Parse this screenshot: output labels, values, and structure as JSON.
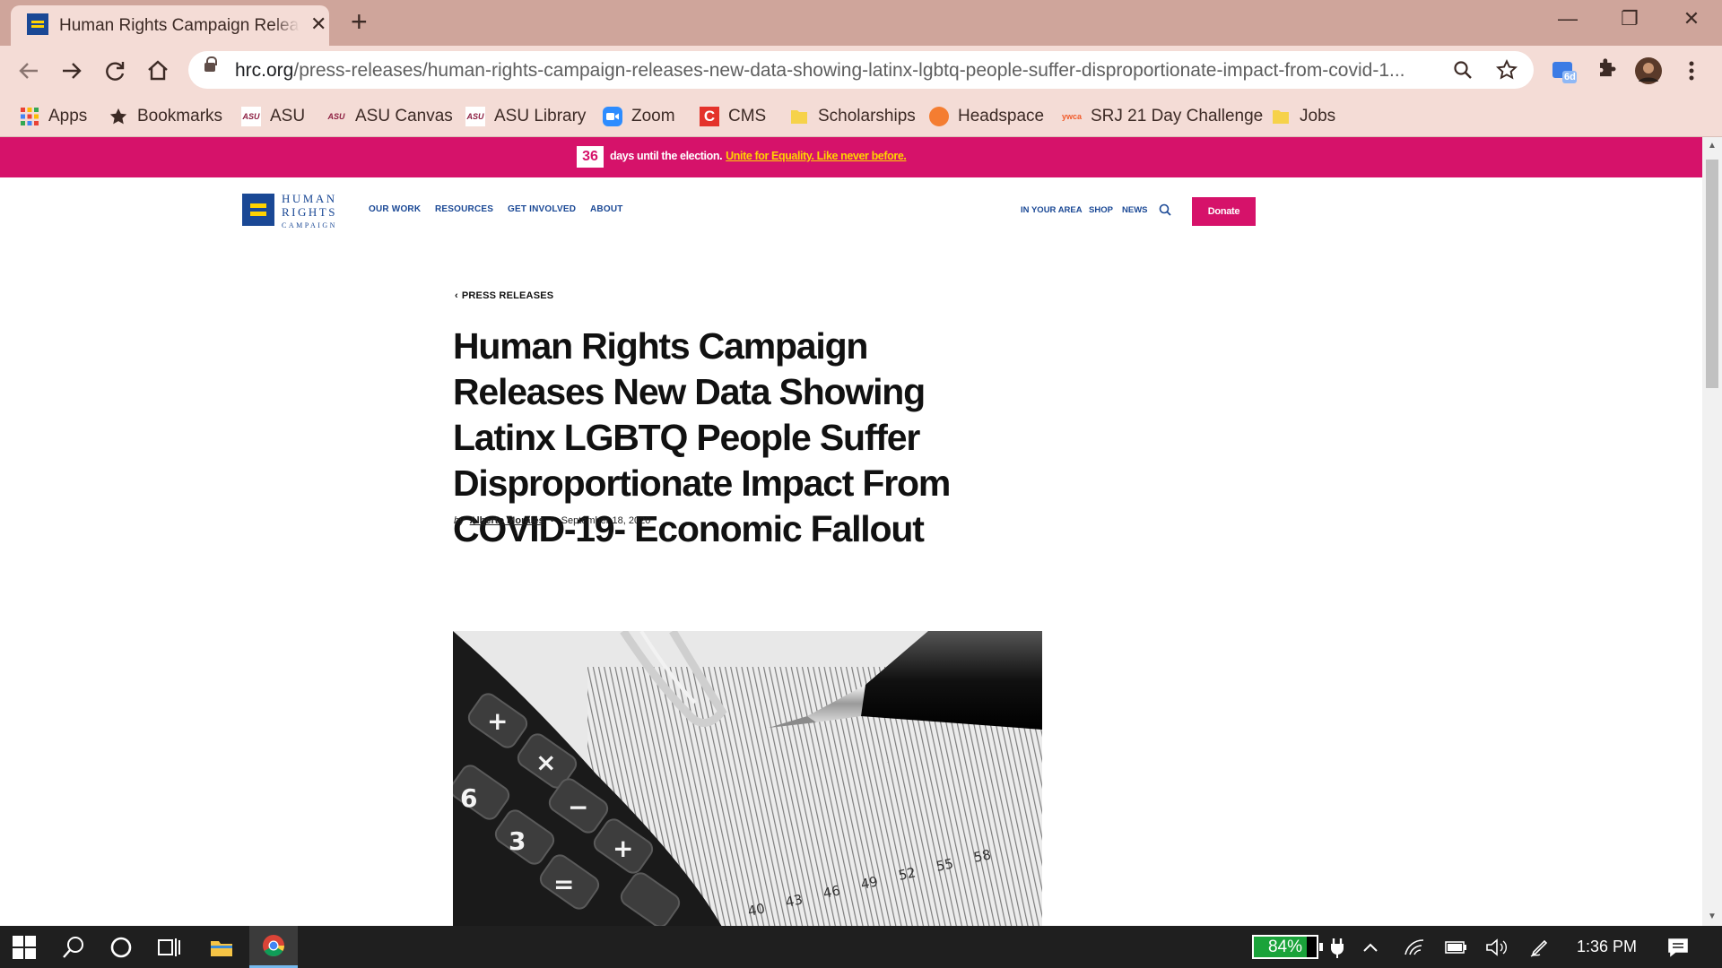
{
  "browser": {
    "tab_title": "Human Rights Campaign Releases New Data Showing Latinx LGBTQ People Suffer",
    "new_tab_symbol": "+",
    "close_symbol": "✕",
    "url_host": "hrc.org",
    "url_path": "/press-releases/human-rights-campaign-releases-new-data-showing-latinx-lgbtq-people-suffer-disproportionate-impact-from-covid-1...",
    "window_controls": {
      "minimize": "—",
      "restore": "❐",
      "close": "✕"
    },
    "extension_badge": "6d"
  },
  "bookmarks": [
    {
      "label": "Apps",
      "icon": "apps-grid-icon"
    },
    {
      "label": "Bookmarks",
      "icon": "star-icon"
    },
    {
      "label": "ASU",
      "icon": "asu-icon"
    },
    {
      "label": "ASU Canvas",
      "icon": "asu-icon"
    },
    {
      "label": "ASU Library",
      "icon": "asu-icon"
    },
    {
      "label": "Zoom",
      "icon": "zoom-icon"
    },
    {
      "label": "CMS",
      "icon": "cms-icon"
    },
    {
      "label": "Scholarships",
      "icon": "folder-icon"
    },
    {
      "label": "Headspace",
      "icon": "headspace-icon"
    },
    {
      "label": "SRJ 21 Day Challenge",
      "icon": "ywca-icon"
    },
    {
      "label": "Jobs",
      "icon": "folder-icon"
    }
  ],
  "bookmark_icon_text": {
    "asu": "ASU",
    "ywca": "ywca",
    "cms": "C"
  },
  "banner": {
    "days": "36",
    "text": "days until the election.",
    "cta": "Unite for Equality. Like never before."
  },
  "site": {
    "logo_lines": [
      "HUMAN",
      "RIGHTS",
      "CAMPAIGN"
    ],
    "nav": [
      "OUR WORK",
      "RESOURCES",
      "GET INVOLVED",
      "ABOUT"
    ],
    "utility_nav": [
      "IN YOUR AREA",
      "SHOP",
      "NEWS"
    ],
    "donate": "Donate"
  },
  "article": {
    "breadcrumb_chevron": "‹",
    "breadcrumb": "PRESS RELEASES",
    "headline": "Human Rights Campaign Releases New Data Showing Latinx LGBTQ People Suffer Disproportionate Impact From COVID-19- Economic Fallout",
    "by": "by",
    "author": "Alberto Morales",
    "separator": "•",
    "date": "September 18, 2020",
    "hero_numbers": [
      "40",
      "43",
      "46",
      "49",
      "52",
      "55",
      "58"
    ]
  },
  "taskbar": {
    "battery_percent": "84%",
    "battery_level": 0.84,
    "time": "1:36 PM"
  },
  "colors": {
    "hrc_blue": "#1a4895",
    "hrc_yellow": "#ffd200",
    "hrc_pink": "#d6126a",
    "chrome_frame": "#cfa59b",
    "chrome_toolbar": "#f4dcd6"
  }
}
